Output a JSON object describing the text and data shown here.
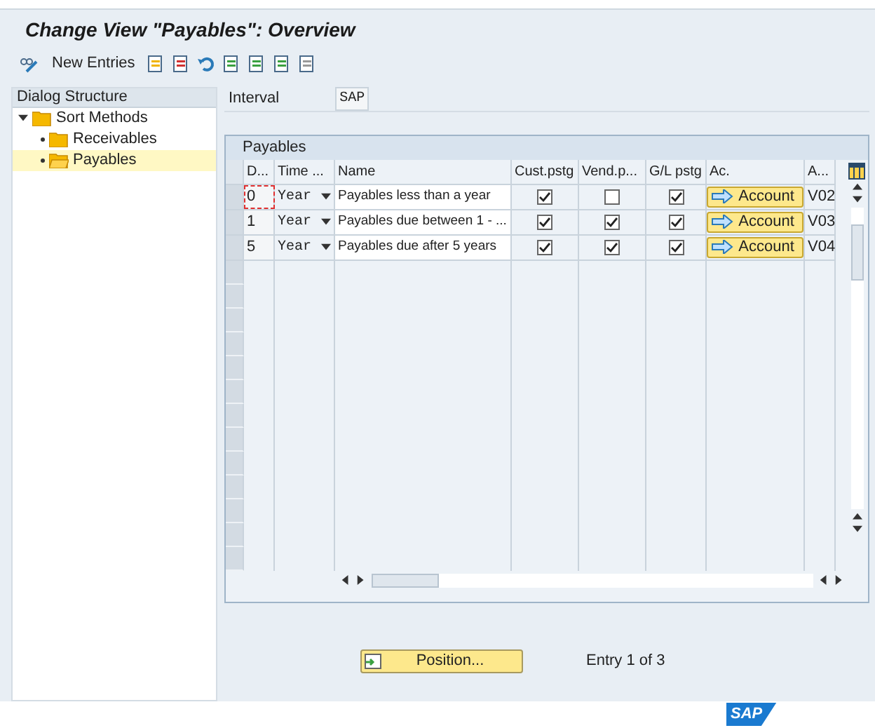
{
  "window": {
    "title": "Change View \"Payables\": Overview"
  },
  "toolbar": {
    "new_entries": "New Entries"
  },
  "dialog_structure": {
    "title": "Dialog Structure",
    "items": [
      {
        "label": "Sort Methods",
        "expanded": true,
        "selected": false,
        "children": [
          {
            "label": "Receivables",
            "selected": false
          },
          {
            "label": "Payables",
            "selected": true
          }
        ]
      }
    ]
  },
  "interval": {
    "label": "Interval",
    "value": "SAP"
  },
  "table": {
    "title": "Payables",
    "columns": [
      "D...",
      "Time ...",
      "Name",
      "Cust.pstg",
      "Vend.p...",
      "G/L pstg",
      "Ac.",
      "A..."
    ],
    "rows": [
      {
        "d": "0",
        "time": "Year",
        "name": "Payables less than a year",
        "cust": true,
        "vend": false,
        "gl": true,
        "account": "Account",
        "a": "V02"
      },
      {
        "d": "1",
        "time": "Year",
        "name": "Payables due between 1 - ...",
        "cust": true,
        "vend": true,
        "gl": true,
        "account": "Account",
        "a": "V03"
      },
      {
        "d": "5",
        "time": "Year",
        "name": "Payables due after 5 years",
        "cust": true,
        "vend": true,
        "gl": true,
        "account": "Account",
        "a": "V04"
      }
    ]
  },
  "position_button": "Position...",
  "entry_info": "Entry 1 of 3",
  "logo": "SAP"
}
